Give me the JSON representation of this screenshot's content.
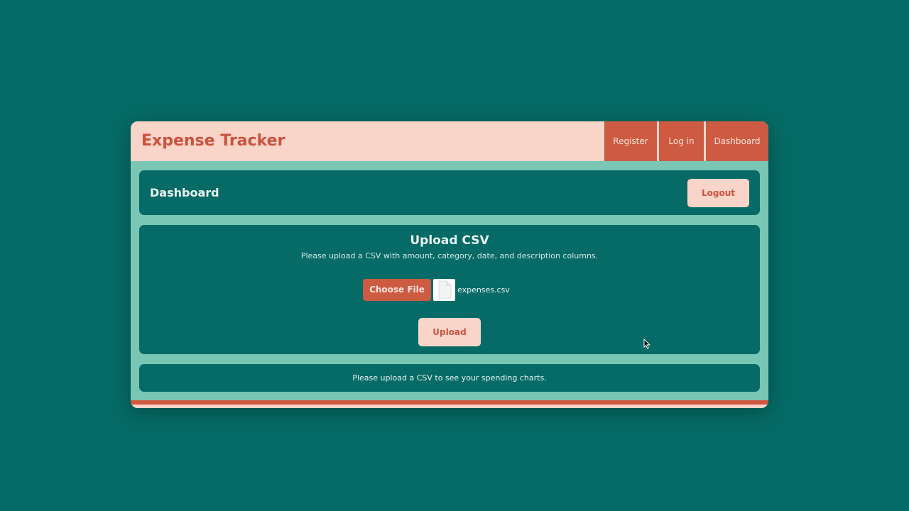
{
  "navbar": {
    "brand": "Expense Tracker",
    "links": [
      "Register",
      "Log in",
      "Dashboard"
    ]
  },
  "dashboard": {
    "title": "Dashboard",
    "logout_label": "Logout"
  },
  "upload": {
    "title": "Upload CSV",
    "description": "Please upload a CSV with amount, category, date, and description columns.",
    "choose_file_label": "Choose File",
    "file_name": "expenses.csv",
    "file_icon": "file-icon",
    "upload_label": "Upload"
  },
  "status": {
    "message": "Please upload a CSV to see your spending charts."
  },
  "colors": {
    "page_background": "#066b66",
    "panel_background": "#066b66",
    "frame": "#7ac6b4",
    "accent": "#cd5b42",
    "light_accent": "#f9d4c9"
  }
}
